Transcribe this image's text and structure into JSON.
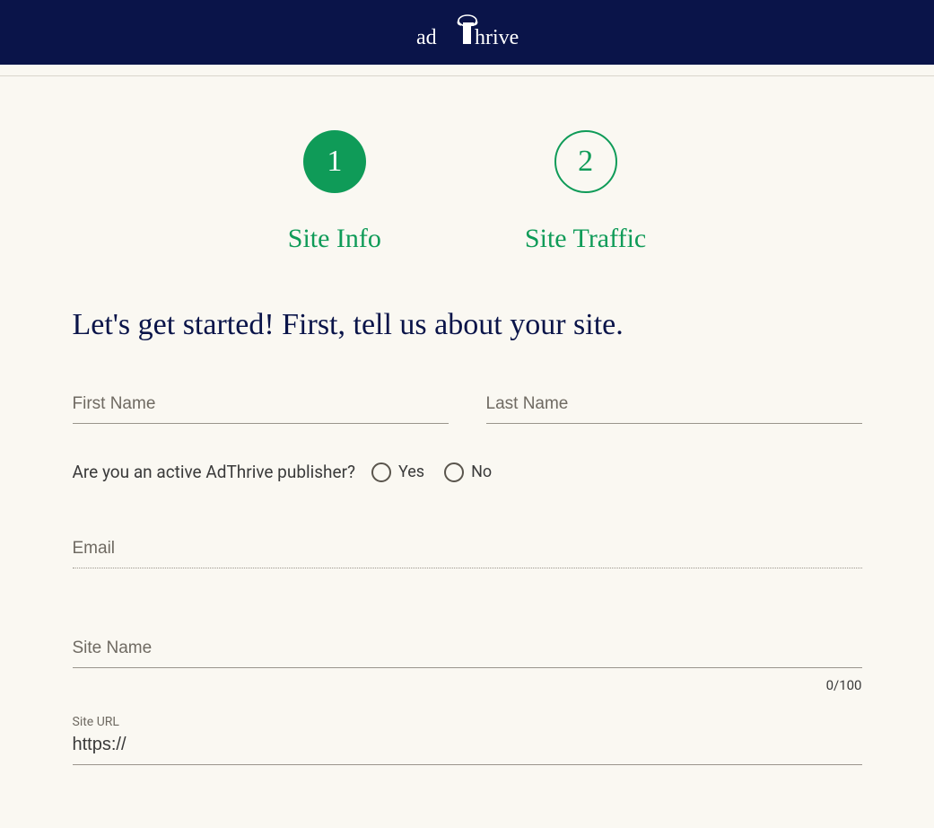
{
  "header": {
    "brand": "adThrive"
  },
  "steps": {
    "step1": {
      "number": "1",
      "label": "Site Info"
    },
    "step2": {
      "number": "2",
      "label": "Site Traffic"
    }
  },
  "heading": "Let's get started! First, tell us about your site.",
  "fields": {
    "firstName": {
      "placeholder": "First Name",
      "value": ""
    },
    "lastName": {
      "placeholder": "Last Name",
      "value": ""
    },
    "publisherQuestion": "Are you an active AdThrive publisher?",
    "yes": "Yes",
    "no": "No",
    "email": {
      "placeholder": "Email",
      "value": ""
    },
    "siteName": {
      "placeholder": "Site Name",
      "value": "",
      "counter": "0/100"
    },
    "siteUrl": {
      "label": "Site URL",
      "value": "https://"
    }
  }
}
